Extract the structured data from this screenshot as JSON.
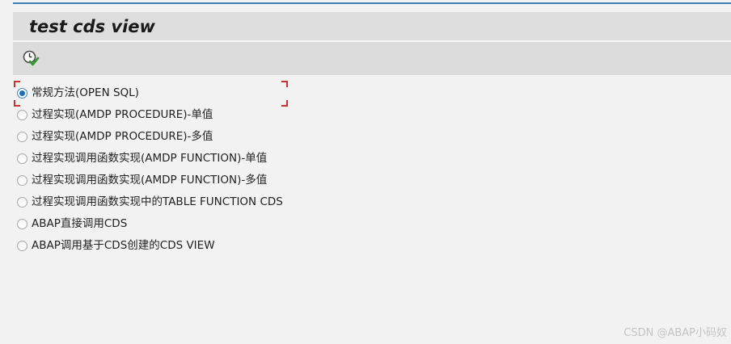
{
  "header": {
    "title": "test cds view"
  },
  "toolbar": {
    "execute_icon": "execute-clock-check-icon"
  },
  "options": [
    {
      "label": "常规方法(OPEN SQL)",
      "checked": true
    },
    {
      "label": "过程实现(AMDP PROCEDURE)-单值",
      "checked": false
    },
    {
      "label": "过程实现(AMDP PROCEDURE)-多值",
      "checked": false
    },
    {
      "label": "过程实现调用函数实现(AMDP FUNCTION)-单值",
      "checked": false
    },
    {
      "label": "过程实现调用函数实现(AMDP FUNCTION)-多值",
      "checked": false
    },
    {
      "label": "过程实现调用函数实现中的TABLE FUNCTION CDS",
      "checked": false
    },
    {
      "label": "ABAP直接调用CDS",
      "checked": false
    },
    {
      "label": "ABAP调用基于CDS创建的CDS VIEW",
      "checked": false
    }
  ],
  "watermark": "CSDN @ABAP小码奴",
  "colors": {
    "accent": "#3d7fb8",
    "focus": "#c8342d",
    "radio_selected": "#1c6fb5"
  }
}
